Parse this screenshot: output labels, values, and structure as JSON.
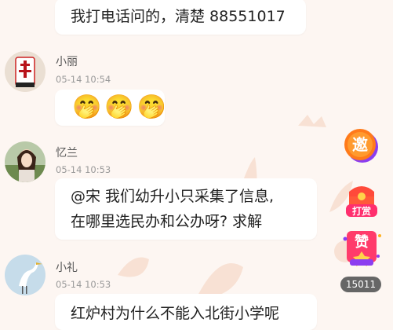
{
  "messages": [
    {
      "text": "我打电话问的，清楚 88551017"
    },
    {
      "name": "小丽",
      "time": "05-14 10:54",
      "emoji": [
        "🤭",
        "🤭",
        "🤭"
      ]
    },
    {
      "name": "忆兰",
      "time": "05-14 10:53",
      "text_line1": "@宋 我们幼升小只采集了信息,",
      "text_line2": "在哪里选民办和公办呀? 求解"
    },
    {
      "name": "小礼",
      "time": "05-14 10:53",
      "text": "红炉村为什么不能入北街小学呢"
    }
  ],
  "side_buttons": {
    "invite": {
      "label": "邀",
      "icon": "invite-icon"
    },
    "reward": {
      "label": "打赏",
      "icon": "reward-chest-icon"
    },
    "like": {
      "label": "赞",
      "icon": "like-badge-icon",
      "count": "15011"
    }
  },
  "colors": {
    "background": "#fdf6f2",
    "accent": "#ff4a6b",
    "invite_orange": "#ff7a1a",
    "like_purple": "#8b3df0"
  }
}
